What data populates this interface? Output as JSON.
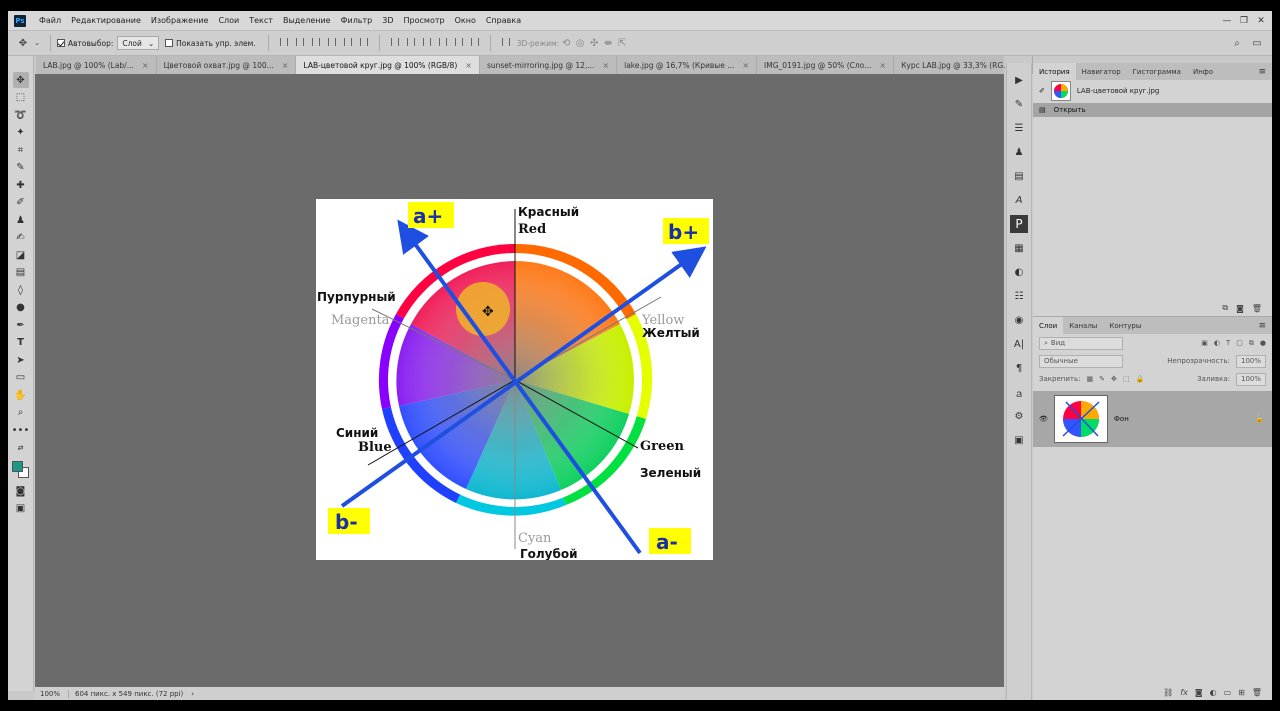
{
  "app": {
    "logo": "Ps"
  },
  "menu": [
    "Файл",
    "Редактирование",
    "Изображение",
    "Слои",
    "Текст",
    "Выделение",
    "Фильтр",
    "3D",
    "Просмотр",
    "Окно",
    "Справка"
  ],
  "window_controls": {
    "minimize": "—",
    "restore": "❐",
    "close": "✕"
  },
  "options_bar": {
    "autoselect_label": "Автовыбор:",
    "autoselect_value": "Слой",
    "show_transform_label": "Показать упр. элем.",
    "mode3d_label": "3D-режим:"
  },
  "tabs": [
    {
      "label": "LAB.jpg @ 100% (Lab/..."
    },
    {
      "label": "Цветовой охват.jpg @ 100..."
    },
    {
      "label": "LAB-цветовой круг.jpg @ 100% (RGB/8)"
    },
    {
      "label": "sunset-mirroring.jpg @ 12,..."
    },
    {
      "label": "lake.jpg @ 16,7% (Кривые ..."
    },
    {
      "label": "IMG_0191.jpg @ 50% (Сло..."
    },
    {
      "label": "Курс LAB.jpg @ 33,3% (RG..."
    }
  ],
  "status": {
    "zoom": "100%",
    "info": "604 пикс. x 549 пикс. (72 ppi)",
    "arrow": "›"
  },
  "history_panel": {
    "tabs": [
      "История",
      "Навигатор",
      "Гистограмма",
      "Инфо"
    ],
    "snapshot": "LAB-цветовой круг.jpg",
    "step": "Открыть"
  },
  "layers_panel": {
    "tabs": [
      "Слои",
      "Каналы",
      "Контуры"
    ],
    "search_placeholder": "Вид",
    "blend_mode": "Обычные",
    "opacity_label": "Непрозрачность:",
    "opacity_value": "100%",
    "lock_label": "Закрепить:",
    "fill_label": "Заливка:",
    "fill_value": "100%",
    "layer_name": "Фон"
  },
  "canvas_image": {
    "labels": {
      "a_plus": "a+",
      "a_minus": "a-",
      "b_plus": "b+",
      "b_minus": "b-",
      "red_ru": "Красный",
      "red_en": "Red",
      "magenta_ru": "Пурпурный",
      "magenta_en": "Magenta",
      "yellow_en": "Yellow",
      "yellow_ru": "Желтый",
      "blue_ru": "Синий",
      "blue_en": "Blue",
      "green_en": "Green",
      "green_ru": "Зеленый",
      "cyan_en": "Cyan",
      "cyan_ru": "Голубой"
    },
    "colors": {
      "arrow": "#1f4fe0",
      "label_bg": "#ffff00",
      "label_text": "#1a2fa8",
      "highlight": "#f0b429"
    }
  }
}
